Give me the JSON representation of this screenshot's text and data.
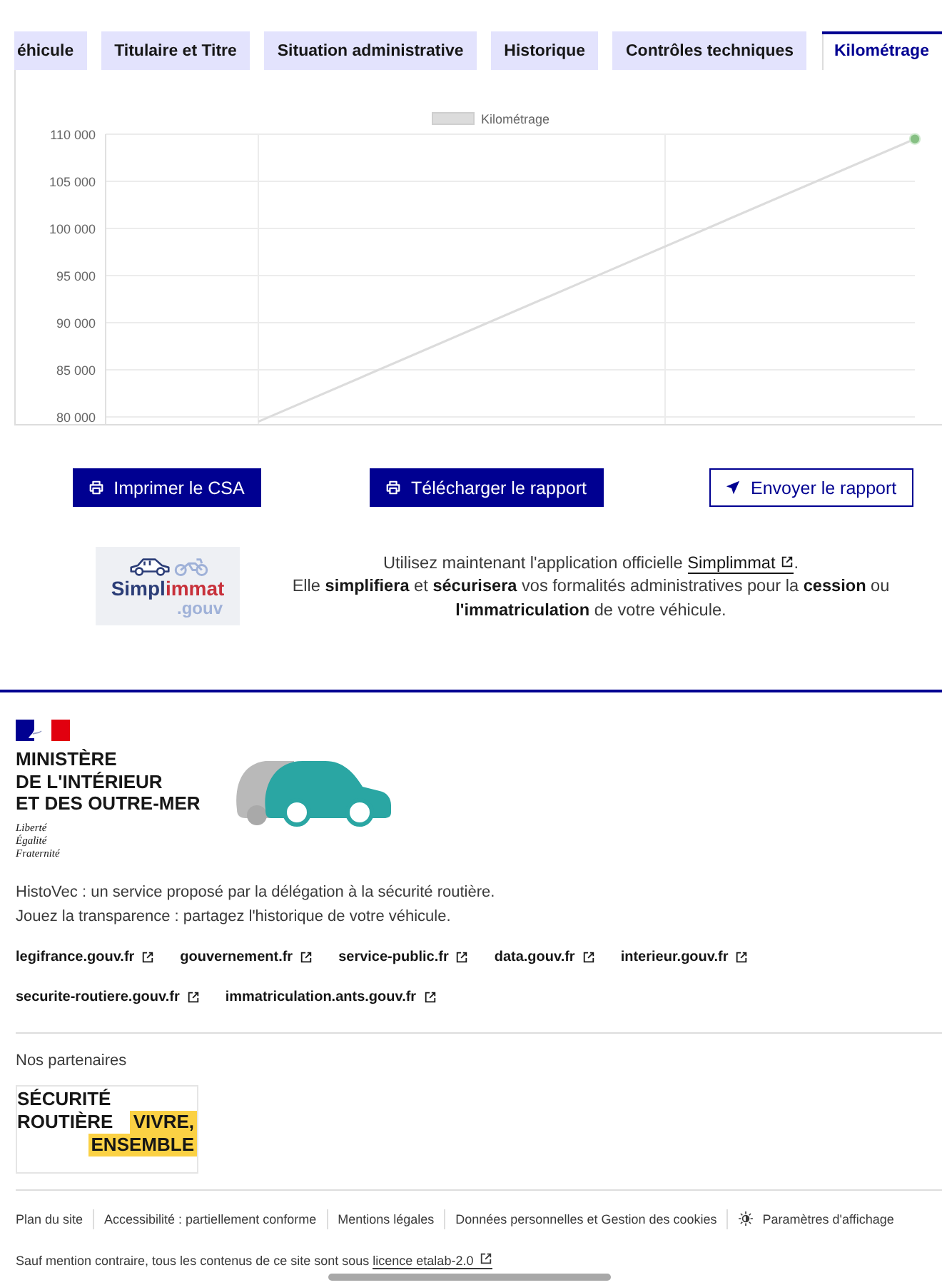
{
  "tabs": [
    {
      "label": "éhicule",
      "selected": false
    },
    {
      "label": "Titulaire et Titre",
      "selected": false
    },
    {
      "label": "Situation administrative",
      "selected": false
    },
    {
      "label": "Historique",
      "selected": false
    },
    {
      "label": "Contrôles techniques",
      "selected": false
    },
    {
      "label": "Kilométrage",
      "selected": true
    }
  ],
  "chart": {
    "chart_data": {
      "type": "line",
      "grid": true,
      "series": [
        {
          "name": "Kilométrage",
          "color": "#dcdcdc",
          "values": [
            79500,
            94500,
            109500
          ]
        }
      ],
      "ylim": [
        79200,
        110000
      ],
      "yticks": [
        {
          "value": 80000,
          "label": "80 000"
        },
        {
          "value": 85000,
          "label": "85 000"
        },
        {
          "value": 90000,
          "label": "90 000"
        },
        {
          "value": 95000,
          "label": "95 000"
        },
        {
          "value": 100000,
          "label": "100 000"
        },
        {
          "value": 105000,
          "label": "105 000"
        },
        {
          "value": 110000,
          "label": "110 000"
        }
      ]
    }
  },
  "actions": [
    {
      "kind": "print",
      "label": "Imprimer le CSA"
    },
    {
      "kind": "print",
      "label": "Télécharger le rapport"
    },
    {
      "kind": "send",
      "label": "Envoyer le rapport"
    }
  ],
  "promo": {
    "logo": {
      "word_1": "Simpl",
      "word_2": "immat",
      "suffix": ".gouv"
    },
    "text_before": "Utilisez maintenant l'application officielle",
    "link": "Simplimmat",
    "text_after": ".",
    "text_2": "Elle **simplifiera** et **sécurisera** vos formalités administratives pour la **cession** ou **l'immatriculation** de votre véhicule."
  },
  "footer": {
    "ministry": [
      "MINISTÈRE",
      "DE L'INTÉRIEUR",
      "ET DES OUTRE-MER"
    ],
    "motto": [
      "Liberté",
      "Égalité",
      "Fraternité"
    ],
    "description": [
      "HistoVec : un service proposé par la délégation à la sécurité routière.",
      "Jouez la transparence : partagez l'historique de votre véhicule."
    ],
    "links": [
      "legifrance.gouv.fr",
      "gouvernement.fr",
      "service-public.fr",
      "data.gouv.fr",
      "interieur.gouv.fr",
      "securite-routiere.gouv.fr",
      "immatriculation.ants.gouv.fr"
    ],
    "partners_title": "Nos partenaires",
    "partner_logo": [
      {
        "text": "SÉCURITÉ",
        "highlight": false
      },
      {
        "text": "ROUTIÈRE",
        "highlight": false
      },
      {
        "text": "VIVRE,",
        "highlight": true
      },
      {
        "text": "ENSEMBLE",
        "highlight": true
      }
    ],
    "bottom_links": [
      {
        "kind": "link",
        "label": "Plan du site"
      },
      {
        "kind": "link",
        "label": "Accessibilité : partiellement conforme"
      },
      {
        "kind": "link",
        "label": "Mentions légales"
      },
      {
        "kind": "link",
        "label": "Données personnelles et Gestion des cookies"
      },
      {
        "kind": "settings",
        "label": "Paramètres d'affichage"
      }
    ],
    "license": {
      "before": "Sauf mention contraire, tous les contenus de ce site sont sous",
      "link": "licence etalab-2.0"
    }
  }
}
